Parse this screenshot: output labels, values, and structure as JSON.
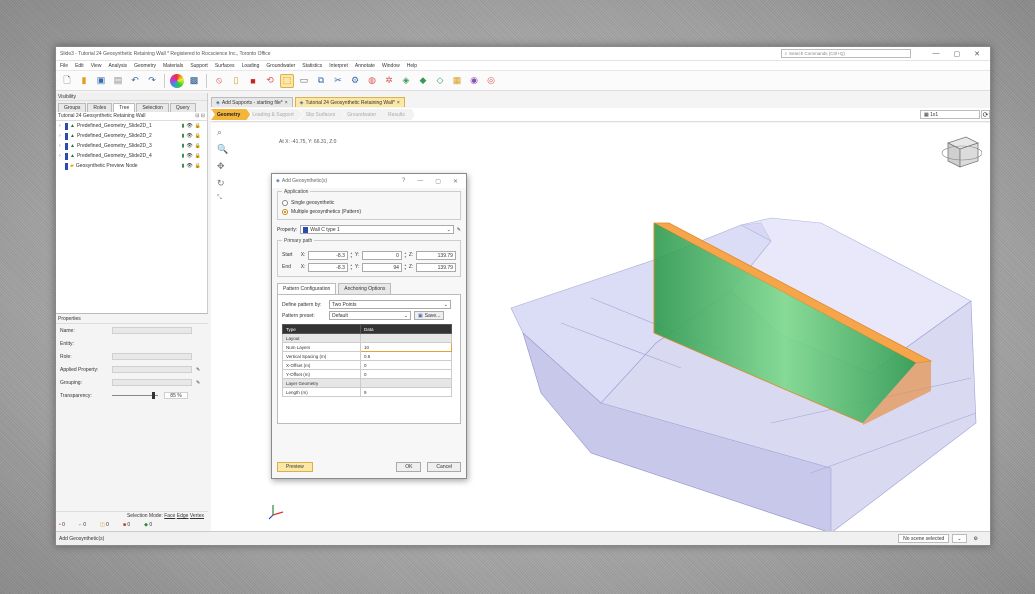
{
  "window": {
    "title": "Slide3 - Tutorial 24 Geosynthetic Retaining Wall *   Registered to Rocscience Inc., Toronto Office",
    "search_placeholder": "Search Commands (Ctrl+Q)",
    "controls": [
      "—",
      "▢",
      "✕"
    ]
  },
  "menu": [
    "File",
    "Edit",
    "View",
    "Analysis",
    "Geometry",
    "Materials",
    "Support",
    "Surfaces",
    "Loading",
    "Groundwater",
    "Statistics",
    "Interpret",
    "Annotate",
    "Window",
    "Help"
  ],
  "visibility": {
    "header": "Visibility",
    "tabs": [
      "Groups",
      "Roles",
      "Tree",
      "Selection",
      "Query"
    ],
    "active_tab": "Tree",
    "tree_title": "Tutorial 24 Geosynthetic Retaining Wall",
    "items": [
      {
        "label": "Predefined_Geometry_Slide2D_1",
        "color": "#2a6e35"
      },
      {
        "label": "Predefined_Geometry_Slide2D_2",
        "color": "#2a6e35"
      },
      {
        "label": "Predefined_Geometry_Slide2D_3",
        "color": "#2a6e35"
      },
      {
        "label": "Predefined_Geometry_Slide2D_4",
        "color": "#2a6e35"
      },
      {
        "label": "Geosynthetic Preview Node",
        "color": "#2a4bb0"
      }
    ]
  },
  "properties": {
    "header": "Properties",
    "fields": [
      "Name:",
      "Entity:",
      "Role:",
      "Applied Property:",
      "Grouping:",
      "Transparency:"
    ],
    "transparency_value": "85 %",
    "selection_mode_label": "Selection Mode:",
    "selection_modes": [
      "Face",
      "Edge",
      "Vertex"
    ],
    "counts": [
      "0",
      "0",
      "0",
      "0",
      "0"
    ]
  },
  "doc_tabs": [
    {
      "label": "Add Supports - starting file*",
      "active": false
    },
    {
      "label": "Tutorial 24 Geosynthetic Retaining Wall*",
      "active": true
    }
  ],
  "workflow": [
    "Geometry",
    "Loading & Support",
    "Slip Surfaces",
    "Groundwater",
    "Results"
  ],
  "active_workflow": "Geometry",
  "layout_value": "1x1",
  "viewport": {
    "coord_readout": "At X: -41.75, Y: 66.31, Z:0"
  },
  "dialog": {
    "title": "Add Geosynthetic(s)",
    "title_controls": [
      "?",
      "—",
      "▢",
      "✕"
    ],
    "application_label": "Application",
    "radio_single": "Single geosynthetic",
    "radio_multiple": "Multiple geosynthetics (Pattern)",
    "property_label": "Property:",
    "property_value": "Wall C type 1",
    "primary_path_label": "Primary path",
    "start_label": "Start",
    "end_label": "End",
    "start": {
      "x": "-8.3",
      "y": "0",
      "z": "139.79"
    },
    "end": {
      "x": "-8.3",
      "y": "94",
      "z": "139.79"
    },
    "tabs": [
      "Pattern Configuration",
      "Anchoring Options"
    ],
    "define_label": "Define pattern by:",
    "define_value": "Two Points",
    "preset_label": "Pattern preset:",
    "preset_value": "Default",
    "save_label": "Save...",
    "table_headers": [
      "Type",
      "Data"
    ],
    "table_rows": [
      {
        "type": "Layout",
        "data": "",
        "category": true
      },
      {
        "type": "Num Layers",
        "data": "10",
        "category": false
      },
      {
        "type": "Vertical Spacing (m)",
        "data": "0.6",
        "category": false
      },
      {
        "type": "X-Offset (m)",
        "data": "0",
        "category": false
      },
      {
        "type": "Y-Offset (m)",
        "data": "0",
        "category": false
      },
      {
        "type": "Layer Geometry",
        "data": "",
        "category": true
      },
      {
        "type": "Length (m)",
        "data": "9",
        "category": false
      }
    ],
    "preview_label": "Preview",
    "ok_label": "OK",
    "cancel_label": "Cancel"
  },
  "status": {
    "left": "Add Geosynthetic(s)",
    "right": "No scene selected"
  }
}
